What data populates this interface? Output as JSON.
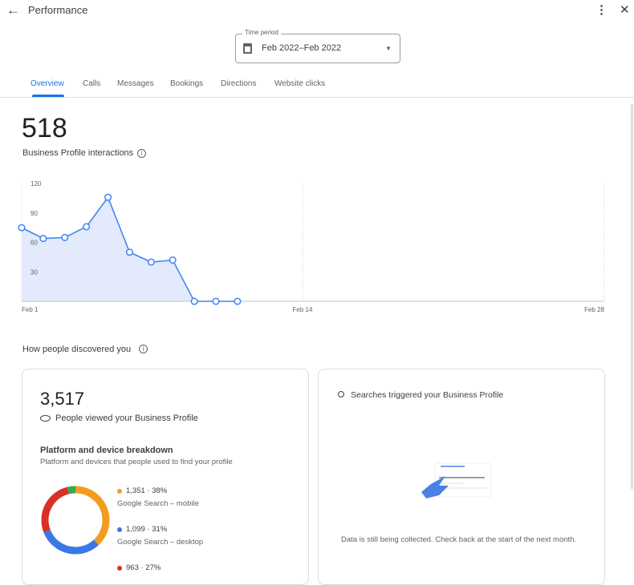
{
  "header": {
    "title": "Performance",
    "back_icon": "arrow-left-icon",
    "menu_icon": "more-vert-icon",
    "close_icon": "close-icon"
  },
  "time_period": {
    "label": "Time period",
    "value": "Feb 2022–Feb 2022",
    "icon": "calendar-icon"
  },
  "tabs": [
    {
      "label": "Overview",
      "active": true
    },
    {
      "label": "Calls"
    },
    {
      "label": "Messages"
    },
    {
      "label": "Bookings"
    },
    {
      "label": "Directions"
    },
    {
      "label": "Website clicks"
    }
  ],
  "accent": "#1a73e8",
  "interactions": {
    "total": "518",
    "label": "Business Profile interactions"
  },
  "chart_data": {
    "type": "area",
    "x": [
      "Feb 1",
      "Feb 2",
      "Feb 3",
      "Feb 4",
      "Feb 5",
      "Feb 6",
      "Feb 7",
      "Feb 8",
      "Feb 9",
      "Feb 10",
      "Feb 11"
    ],
    "values": [
      75,
      64,
      65,
      76,
      106,
      50,
      40,
      42,
      0,
      0,
      0
    ],
    "ylim": [
      0,
      120
    ],
    "yticks": [
      "30",
      "60",
      "90",
      "120"
    ],
    "xticks": [
      "Feb 1",
      "Feb 14",
      "Feb 28"
    ],
    "color": "#4285f4"
  },
  "discovery": {
    "title": "How people discovered you",
    "views": {
      "total": "3,517",
      "label": "People viewed your Business Profile"
    },
    "breakdown": {
      "title": "Platform and device breakdown",
      "subtitle": "Platform and devices that people used to find your profile",
      "chart_data": {
        "type": "pie",
        "segments": [
          {
            "value": "1,351 · 38%",
            "label": "Google Search – mobile",
            "pct": 38,
            "color": "#f29d1f"
          },
          {
            "value": "1,099 · 31%",
            "label": "Google Search – desktop",
            "pct": 31,
            "color": "#3b78e7"
          },
          {
            "value": "963 · 27%",
            "label": "",
            "pct": 27,
            "color": "#d93025"
          },
          {
            "pct": 4,
            "color": "#34a853"
          }
        ]
      }
    },
    "searches": {
      "title": "Searches triggered your Business Profile",
      "message": "Data is still being collected. Check back at the start of the next month."
    }
  }
}
